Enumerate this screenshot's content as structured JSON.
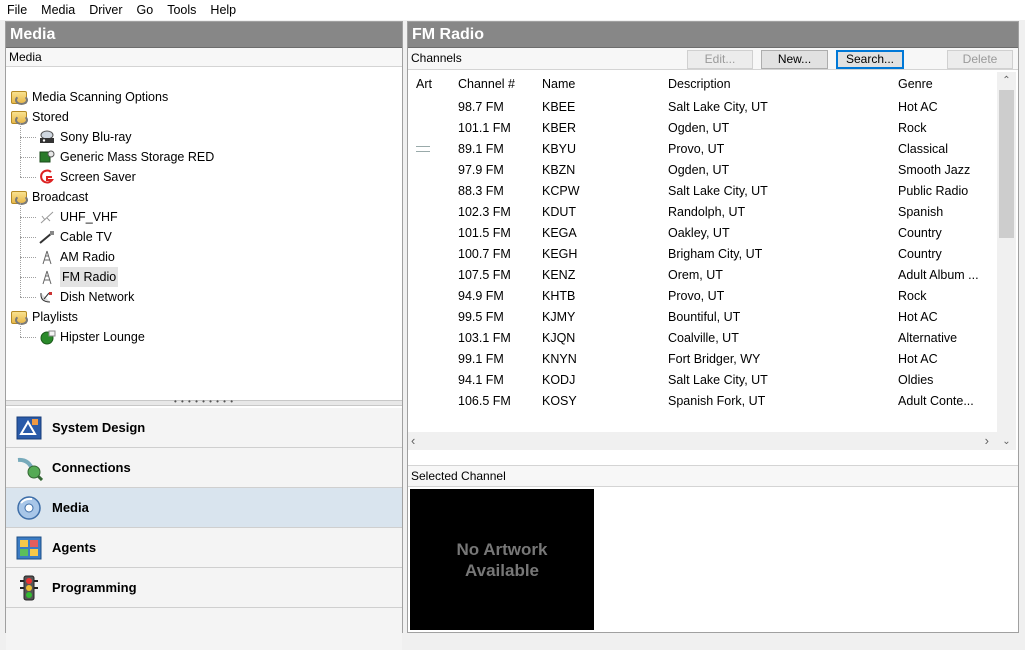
{
  "menu": [
    "File",
    "Media",
    "Driver",
    "Go",
    "Tools",
    "Help"
  ],
  "left": {
    "title": "Media",
    "subheader": "Media",
    "tree": [
      {
        "label": "Media Scanning Options",
        "icon": "folder-icon",
        "level": 1
      },
      {
        "label": "Stored",
        "icon": "folder-icon",
        "level": 1
      },
      {
        "label": "Sony Blu-ray",
        "icon": "bluray-player-icon",
        "level": 2
      },
      {
        "label": "Generic Mass Storage RED",
        "icon": "storage-icon",
        "level": 2
      },
      {
        "label": "Screen Saver",
        "icon": "screen-saver-icon",
        "level": 2
      },
      {
        "label": "Broadcast",
        "icon": "folder-icon",
        "level": 1
      },
      {
        "label": "UHF_VHF",
        "icon": "antenna-icon",
        "level": 2
      },
      {
        "label": "Cable TV",
        "icon": "cable-icon",
        "level": 2
      },
      {
        "label": "AM Radio",
        "icon": "radio-tower-icon",
        "level": 2
      },
      {
        "label": "FM Radio",
        "icon": "radio-tower-icon",
        "level": 2,
        "selected": true
      },
      {
        "label": "Dish Network",
        "icon": "satellite-dish-icon",
        "level": 2
      },
      {
        "label": "Playlists",
        "icon": "folder-icon",
        "level": 1
      },
      {
        "label": "Hipster Lounge",
        "icon": "playlist-icon",
        "level": 2
      }
    ],
    "nav": [
      {
        "label": "System Design",
        "icon": "system-design-icon"
      },
      {
        "label": "Connections",
        "icon": "connections-icon"
      },
      {
        "label": "Media",
        "icon": "media-disc-icon",
        "active": true
      },
      {
        "label": "Agents",
        "icon": "agents-icon"
      },
      {
        "label": "Programming",
        "icon": "traffic-light-icon"
      }
    ]
  },
  "right": {
    "title": "FM Radio",
    "channels_label": "Channels",
    "buttons": {
      "edit": "Edit...",
      "new": "New...",
      "search": "Search...",
      "delete": "Delete"
    },
    "columns": {
      "art": "Art",
      "channel": "Channel #",
      "name": "Name",
      "description": "Description",
      "genre": "Genre"
    },
    "rows": [
      {
        "channel": "98.7 FM",
        "name": "KBEE",
        "description": "Salt Lake City, UT",
        "genre": "Hot AC",
        "art": false
      },
      {
        "channel": "101.1 FM",
        "name": "KBER",
        "description": "Ogden, UT",
        "genre": "Rock",
        "art": false
      },
      {
        "channel": "89.1 FM",
        "name": "KBYU",
        "description": "Provo, UT",
        "genre": "Classical",
        "art": true
      },
      {
        "channel": "97.9 FM",
        "name": "KBZN",
        "description": "Ogden, UT",
        "genre": "Smooth Jazz",
        "art": false
      },
      {
        "channel": "88.3 FM",
        "name": "KCPW",
        "description": "Salt Lake City, UT",
        "genre": "Public Radio",
        "art": false
      },
      {
        "channel": "102.3 FM",
        "name": "KDUT",
        "description": "Randolph, UT",
        "genre": "Spanish",
        "art": false
      },
      {
        "channel": "101.5 FM",
        "name": "KEGA",
        "description": "Oakley, UT",
        "genre": "Country",
        "art": false
      },
      {
        "channel": "100.7 FM",
        "name": "KEGH",
        "description": "Brigham City, UT",
        "genre": "Country",
        "art": false
      },
      {
        "channel": "107.5 FM",
        "name": "KENZ",
        "description": "Orem, UT",
        "genre": "Adult Album ...",
        "art": false
      },
      {
        "channel": "94.9 FM",
        "name": "KHTB",
        "description": "Provo, UT",
        "genre": "Rock",
        "art": false
      },
      {
        "channel": "99.5 FM",
        "name": "KJMY",
        "description": "Bountiful, UT",
        "genre": "Hot AC",
        "art": false
      },
      {
        "channel": "103.1 FM",
        "name": "KJQN",
        "description": "Coalville, UT",
        "genre": "Alternative",
        "art": false
      },
      {
        "channel": "99.1 FM",
        "name": "KNYN",
        "description": "Fort Bridger, WY",
        "genre": "Hot AC",
        "art": false
      },
      {
        "channel": "94.1 FM",
        "name": "KODJ",
        "description": "Salt Lake City, UT",
        "genre": "Oldies",
        "art": false
      },
      {
        "channel": "106.5 FM",
        "name": "KOSY",
        "description": "Spanish Fork, UT",
        "genre": "Adult Conte...",
        "art": false
      }
    ],
    "selected_label": "Selected Channel",
    "artwork_placeholder": {
      "line1": "No Artwork",
      "line2": "Available"
    }
  },
  "colors": {
    "title_bar": "#878787",
    "active_nav": "#d9e4ee",
    "focus_border": "#0078d7"
  }
}
